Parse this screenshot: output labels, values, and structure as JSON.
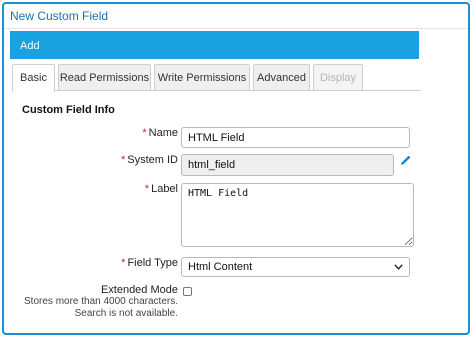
{
  "dialog": {
    "title": "New Custom Field"
  },
  "action_bar": {
    "label": "Add"
  },
  "tabs": [
    {
      "label": "Basic",
      "state": "active"
    },
    {
      "label": "Read Permissions",
      "state": "normal"
    },
    {
      "label": "Write Permissions",
      "state": "normal"
    },
    {
      "label": "Advanced",
      "state": "normal"
    },
    {
      "label": "Display",
      "state": "disabled"
    }
  ],
  "section": {
    "title": "Custom Field Info"
  },
  "form": {
    "required_marker": "*",
    "name": {
      "label": "Name",
      "value": "HTML Field"
    },
    "system_id": {
      "label": "System ID",
      "value": "html_field",
      "edit_icon": "pencil-icon"
    },
    "label": {
      "label": "Label",
      "value": "HTML Field"
    },
    "field_type": {
      "label": "Field Type",
      "selected": "Html Content"
    },
    "extended_mode": {
      "label": "Extended Mode",
      "checked": false,
      "help_line1": "Stores more than 4000 characters.",
      "help_line2": "Search is not available."
    }
  },
  "colors": {
    "accent": "#19a2df",
    "frame": "#1a8fd6",
    "title": "#1a6fb0",
    "required": "#c62828"
  }
}
